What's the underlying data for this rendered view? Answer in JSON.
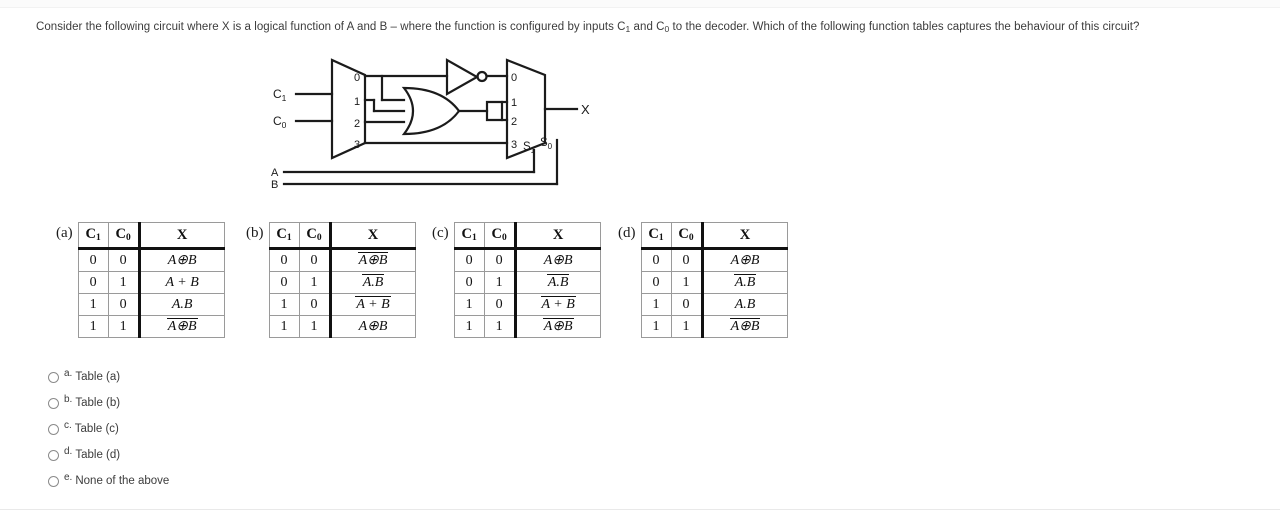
{
  "question": {
    "part1": "Consider the following circuit where X is a logical function of A and B – where the function is configured by inputs C",
    "sub1": "1",
    "part2": " and C",
    "sub2": "0",
    "part3": " to the decoder. Which of the following function tables captures the behaviour of this circuit?"
  },
  "circuit": {
    "input_c1": "C",
    "input_c1_sub": "1",
    "input_c0": "C",
    "input_c0_sub": "0",
    "input_a": "A",
    "input_b": "B",
    "output_x": "X",
    "decoder_outputs": [
      "0",
      "1",
      "2",
      "3"
    ],
    "mux_inputs": [
      "0",
      "1",
      "2",
      "3"
    ],
    "mux_sel_s1": "S",
    "mux_sel_s1_sub": "1",
    "mux_sel_s0": "S",
    "mux_sel_s0_sub": "0"
  },
  "tables": [
    {
      "label": "(a)",
      "headers": {
        "c1": "C",
        "c1_sub": "1",
        "c0": "C",
        "c0_sub": "0",
        "x": "X"
      },
      "rows": [
        {
          "c1": "0",
          "c0": "0",
          "x_plain": "",
          "x_bar": "",
          "x_full": "A⊕B",
          "overline": false
        },
        {
          "c1": "0",
          "c0": "1",
          "x_full": "A + B",
          "overline": false
        },
        {
          "c1": "1",
          "c0": "0",
          "x_full": "A.B",
          "overline": false
        },
        {
          "c1": "1",
          "c0": "1",
          "x_full": "A⊕B",
          "overline": true
        }
      ]
    },
    {
      "label": "(b)",
      "headers": {
        "c1": "C",
        "c1_sub": "1",
        "c0": "C",
        "c0_sub": "0",
        "x": "X"
      },
      "rows": [
        {
          "c1": "0",
          "c0": "0",
          "x_full": "A⊕B",
          "overline": true
        },
        {
          "c1": "0",
          "c0": "1",
          "x_full": "A.B",
          "overline": true
        },
        {
          "c1": "1",
          "c0": "0",
          "x_full": "A + B",
          "overline": true
        },
        {
          "c1": "1",
          "c0": "1",
          "x_full": "A⊕B",
          "overline": false
        }
      ]
    },
    {
      "label": "(c)",
      "headers": {
        "c1": "C",
        "c1_sub": "1",
        "c0": "C",
        "c0_sub": "0",
        "x": "X"
      },
      "rows": [
        {
          "c1": "0",
          "c0": "0",
          "x_full": "A⊕B",
          "overline": false
        },
        {
          "c1": "0",
          "c0": "1",
          "x_full": "A.B",
          "overline": true
        },
        {
          "c1": "1",
          "c0": "0",
          "x_full": "A + B",
          "overline": true
        },
        {
          "c1": "1",
          "c0": "1",
          "x_full": "A⊕B",
          "overline": true
        }
      ]
    },
    {
      "label": "(d)",
      "headers": {
        "c1": "C",
        "c1_sub": "1",
        "c0": "C",
        "c0_sub": "0",
        "x": "X"
      },
      "rows": [
        {
          "c1": "0",
          "c0": "0",
          "x_full": "A⊕B",
          "overline": false
        },
        {
          "c1": "0",
          "c0": "1",
          "x_full": "A.B",
          "overline": true
        },
        {
          "c1": "1",
          "c0": "0",
          "x_full": "A.B",
          "overline": false
        },
        {
          "c1": "1",
          "c0": "1",
          "x_full": "A⊕B",
          "overline": true
        }
      ]
    }
  ],
  "options": [
    {
      "letter": "a.",
      "text": "Table (a)"
    },
    {
      "letter": "b.",
      "text": "Table (b)"
    },
    {
      "letter": "c.",
      "text": "Table (c)"
    },
    {
      "letter": "d.",
      "text": "Table (d)"
    },
    {
      "letter": "e.",
      "text": "None of the above"
    }
  ]
}
